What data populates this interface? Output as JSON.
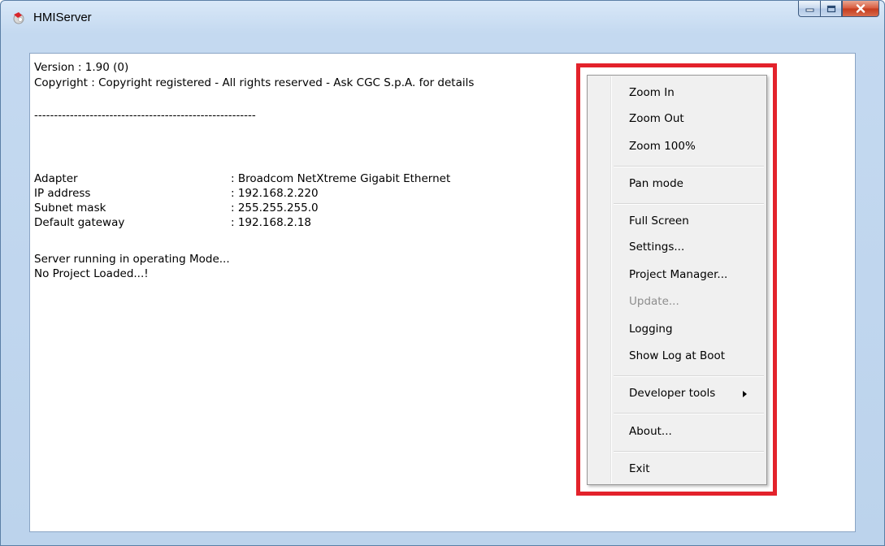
{
  "window": {
    "title": "HMIServer",
    "icon": "hmiserver-app-icon",
    "caption_buttons": [
      "minimize-icon",
      "maximize-icon",
      "close-icon"
    ]
  },
  "info": {
    "version_line": "Version : 1.90 (0)",
    "copyright_line": "Copyright : Copyright registered - All rights reserved - Ask CGC S.p.A. for details",
    "separator": "--------------------------------------------------------",
    "network": [
      {
        "label": "Adapter",
        "value": ": Broadcom NetXtreme Gigabit Ethernet"
      },
      {
        "label": "IP address",
        "value": ": 192.168.2.220"
      },
      {
        "label": "Subnet mask",
        "value": ": 255.255.255.0"
      },
      {
        "label": "Default gateway",
        "value": ": 192.168.2.18"
      }
    ],
    "status_line1": "Server running in operating Mode...",
    "status_line2": "No Project Loaded...!"
  },
  "context_menu": {
    "items": [
      {
        "label": "Zoom In"
      },
      {
        "label": "Zoom Out"
      },
      {
        "label": "Zoom 100%"
      },
      {
        "label": "Pan mode"
      },
      {
        "label": "Full Screen"
      },
      {
        "label": "Settings..."
      },
      {
        "label": "Project Manager..."
      },
      {
        "label": "Update...",
        "disabled": true
      },
      {
        "label": "Logging"
      },
      {
        "label": "Show Log at Boot"
      },
      {
        "label": "Developer tools",
        "submenu": true
      },
      {
        "label": "About..."
      },
      {
        "label": "Exit"
      }
    ],
    "highlight_color": "#e3222b"
  }
}
